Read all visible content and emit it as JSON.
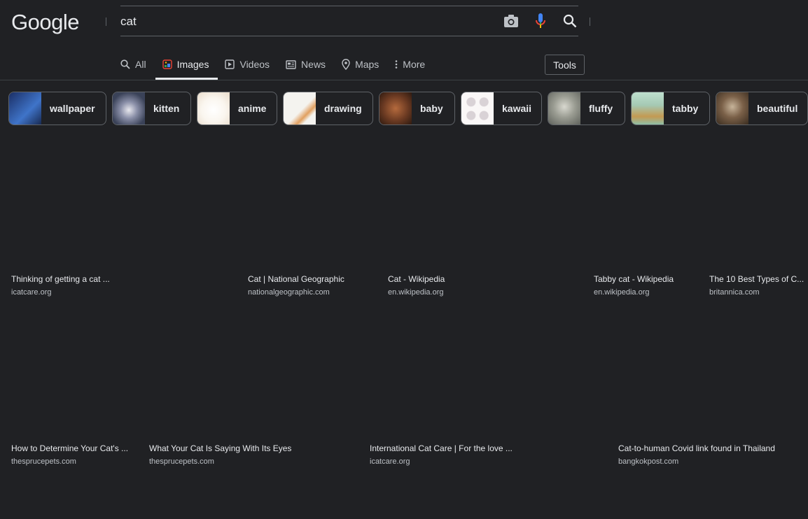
{
  "header": {
    "logo": "Google",
    "query": "cat"
  },
  "tabs": [
    {
      "label": "All",
      "icon": "search-icon",
      "active": false
    },
    {
      "label": "Images",
      "icon": "images-icon",
      "active": true
    },
    {
      "label": "Videos",
      "icon": "play-icon",
      "active": false
    },
    {
      "label": "News",
      "icon": "news-icon",
      "active": false
    },
    {
      "label": "Maps",
      "icon": "map-pin-icon",
      "active": false
    },
    {
      "label": "More",
      "icon": "more-vert-icon",
      "active": false
    }
  ],
  "tools_label": "Tools",
  "chips": [
    {
      "label": "wallpaper",
      "thumb_color": "#2b4f8f"
    },
    {
      "label": "kitten",
      "thumb_color": "#5a5f78"
    },
    {
      "label": "anime",
      "thumb_color": "#f3ede4"
    },
    {
      "label": "drawing",
      "thumb_color": "#f1f0ec"
    },
    {
      "label": "baby",
      "thumb_color": "#6a3b24"
    },
    {
      "label": "kawaii",
      "thumb_color": "#f5f1f0"
    },
    {
      "label": "fluffy",
      "thumb_color": "#8d8f86"
    },
    {
      "label": "tabby",
      "thumb_color": "#9cc3b0"
    },
    {
      "label": "beautiful",
      "thumb_color": "#5c4a3a"
    }
  ],
  "results_row1": [
    {
      "title": "Thinking of getting a cat ...",
      "source": "icatcare.org"
    },
    {
      "title": "Cat | National Geographic",
      "source": "nationalgeographic.com"
    },
    {
      "title": "Cat - Wikipedia",
      "source": "en.wikipedia.org"
    },
    {
      "title": "Tabby cat - Wikipedia",
      "source": "en.wikipedia.org"
    },
    {
      "title": "The 10 Best Types of C...",
      "source": "britannica.com"
    }
  ],
  "results_row2": [
    {
      "title": "How to Determine Your Cat's ...",
      "source": "thesprucepets.com"
    },
    {
      "title": "What Your Cat Is Saying With Its Eyes",
      "source": "thesprucepets.com"
    },
    {
      "title": "International Cat Care | For the love ...",
      "source": "icatcare.org"
    },
    {
      "title": "Cat-to-human Covid link found in Thailand",
      "source": "bangkokpost.com"
    }
  ]
}
